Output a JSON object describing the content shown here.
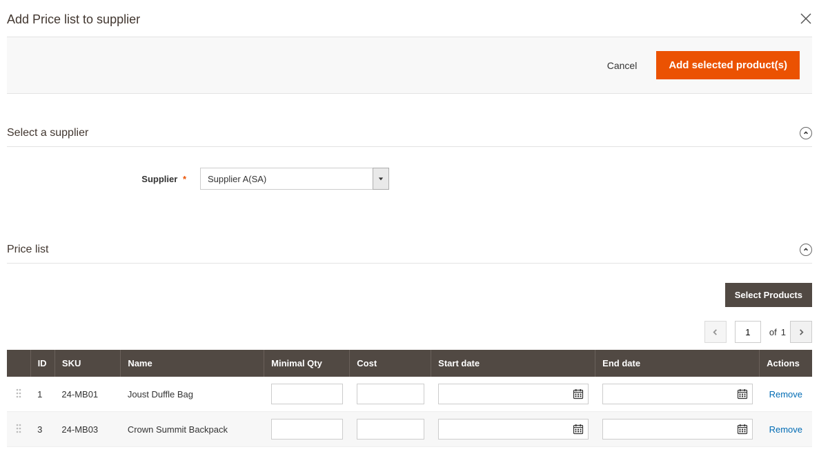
{
  "modal": {
    "title": "Add Price list to supplier",
    "cancel_label": "Cancel",
    "add_label": "Add selected product(s)"
  },
  "sections": {
    "supplier_title": "Select a supplier",
    "pricelist_title": "Price list"
  },
  "supplier": {
    "label": "Supplier",
    "required_mark": "*",
    "value": "Supplier A(SA)"
  },
  "toolbar": {
    "select_products": "Select Products"
  },
  "pager": {
    "current": "1",
    "of_label": "of",
    "total": "1"
  },
  "grid": {
    "headers": {
      "id": "ID",
      "sku": "SKU",
      "name": "Name",
      "min_qty": "Minimal Qty",
      "cost": "Cost",
      "start_date": "Start date",
      "end_date": "End date",
      "actions": "Actions"
    },
    "rows": [
      {
        "id": "1",
        "sku": "24-MB01",
        "name": "Joust Duffle Bag",
        "min_qty": "",
        "cost": "",
        "start_date": "",
        "end_date": "",
        "action": "Remove"
      },
      {
        "id": "3",
        "sku": "24-MB03",
        "name": "Crown Summit Backpack",
        "min_qty": "",
        "cost": "",
        "start_date": "",
        "end_date": "",
        "action": "Remove"
      }
    ]
  }
}
